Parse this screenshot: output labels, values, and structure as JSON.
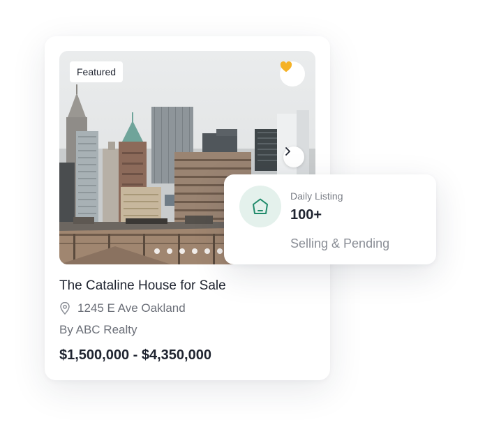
{
  "listing": {
    "badge": "Featured",
    "title": "The Cataline House for Sale",
    "address": "1245 E Ave Oakland",
    "agency": "By ABC Realty",
    "price": "$1,500,000 - $4,350,000",
    "image_subject": "city-skyline-photo",
    "favorite_icon": "heart-icon",
    "next_icon": "chevron-right-icon",
    "location_icon": "map-pin-icon",
    "carousel_dots": 6,
    "colors": {
      "favorite": "#F5B227",
      "text_primary": "#1F2430",
      "text_secondary": "#6B6F78"
    }
  },
  "stats": {
    "label": "Daily Listing",
    "count": "100+",
    "subtitle": "Selling & Pending",
    "icon": "house-icon",
    "colors": {
      "icon": "#1F8A6A",
      "icon_background": "#E4F1EC"
    }
  }
}
